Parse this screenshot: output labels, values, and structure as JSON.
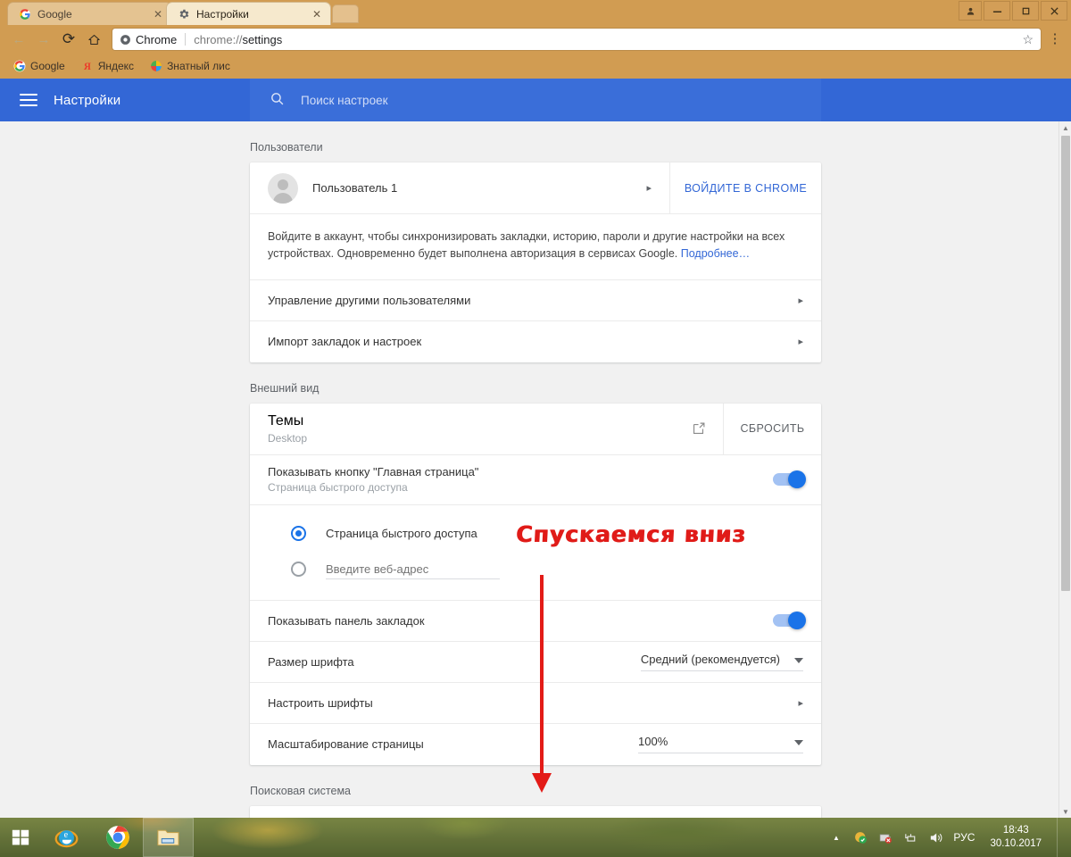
{
  "browser": {
    "tabs": [
      {
        "title": "Google",
        "favicon": "google-icon",
        "active": false
      },
      {
        "title": "Настройки",
        "favicon": "gear-icon",
        "active": true
      }
    ],
    "toolbar": {
      "back": "←",
      "forward": "→",
      "reload": "⟳",
      "home": "⌂",
      "chip_label": "Chrome",
      "url_prefix": "chrome://",
      "url_suffix": "settings",
      "star": "☆",
      "menu": "⋮"
    },
    "bookmarks": [
      {
        "label": "Google",
        "icon": "google-icon"
      },
      {
        "label": "Яндекс",
        "icon": "yandex-icon"
      },
      {
        "label": "Знатный лис",
        "icon": "firefox-icon"
      }
    ],
    "window_controls": {
      "user": "👤",
      "minimize": "—",
      "maximize": "❐",
      "close": "✕"
    }
  },
  "settings": {
    "title": "Настройки",
    "search": {
      "placeholder": "Поиск настроек",
      "icon": "search-icon"
    },
    "sections": {
      "users": {
        "title": "Пользователи",
        "profile_name": "Пользователь 1",
        "profile_arrow": "▸",
        "signin_button": "ВОЙДИТЕ В CHROME",
        "sync_description": "Войдите в аккаунт, чтобы синхронизировать закладки, историю, пароли и другие настройки на всех устройствах. Одновременно будет выполнена авторизация в сервисах Google.",
        "sync_link": "Подробнее…",
        "rows": [
          {
            "label": "Управление другими пользователями",
            "arrow": "▸"
          },
          {
            "label": "Импорт закладок и настроек",
            "arrow": "▸"
          }
        ]
      },
      "appearance": {
        "title": "Внешний вид",
        "themes": {
          "label": "Темы",
          "value": "Desktop",
          "external_icon": "external-link-icon",
          "reset_button": "СБРОСИТЬ"
        },
        "home_button": {
          "label": "Показывать кнопку \"Главная страница\"",
          "sub": "Страница быстрого доступа",
          "toggle": "on"
        },
        "home_options": {
          "option_ntp": "Страница быстрого доступа",
          "option_url_placeholder": "Введите веб-адрес",
          "selected": "ntp"
        },
        "bookmarks_bar": {
          "label": "Показывать панель закладок",
          "toggle": "on"
        },
        "font_size": {
          "label": "Размер шрифта",
          "value": "Средний (рекомендуется)"
        },
        "customize_fonts": {
          "label": "Настроить шрифты",
          "arrow": "▸"
        },
        "page_zoom": {
          "label": "Масштабирование страницы",
          "value": "100%"
        }
      },
      "search_engine": {
        "title": "Поисковая система"
      }
    }
  },
  "annotation": {
    "text": "Спускаемся вниз",
    "color": "#e31b17",
    "arrow": "down-arrow"
  },
  "taskbar": {
    "start": "windows-logo-icon",
    "items": [
      {
        "icon": "internet-explorer-icon",
        "active": false
      },
      {
        "icon": "chrome-icon",
        "active": false
      },
      {
        "icon": "file-explorer-icon",
        "active": true
      }
    ],
    "tray": {
      "expand": "▲",
      "icons": [
        "antivirus-icon",
        "battery-icon",
        "network-icon",
        "volume-icon"
      ],
      "language": "РУС",
      "time": "18:43",
      "date": "30.10.2017"
    }
  }
}
